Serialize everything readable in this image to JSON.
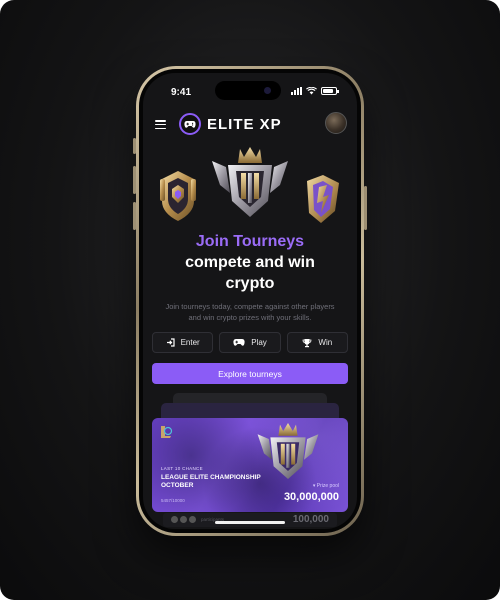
{
  "status_bar": {
    "time": "9:41"
  },
  "header": {
    "brand": "ELITE XP"
  },
  "hero": {
    "title_accent": "Join Tourneys",
    "title_line1": "compete and win",
    "title_line2": "crypto",
    "subtitle": "Join tourneys today, compete against other players and win crypto prizes with your skills."
  },
  "actions": [
    {
      "label": "Enter",
      "icon": "enter-icon"
    },
    {
      "label": "Play",
      "icon": "gamepad-icon"
    },
    {
      "label": "Win",
      "icon": "trophy-icon"
    }
  ],
  "explore": {
    "label": "Explore tourneys"
  },
  "card": {
    "tag": "LAST 10 CHANCE",
    "title": "LEAGUE ELITE CHAMPIONSHIP OCTOBER",
    "count": "5457/10000",
    "prize_label": "Prize pool",
    "prize": "30,000,000"
  },
  "below_card": {
    "label": "participants",
    "value": "100,000"
  },
  "colors": {
    "accent": "#8b5cf6",
    "background": "#151517",
    "gold": "#c9a56a"
  }
}
